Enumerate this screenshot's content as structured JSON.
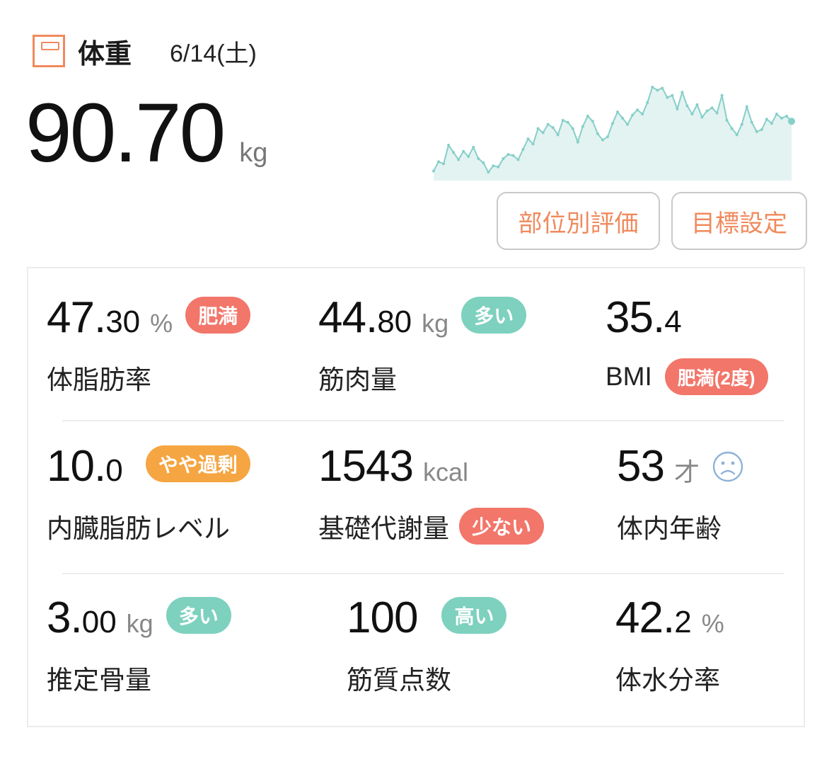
{
  "header": {
    "title": "体重",
    "date": "6/14(土)"
  },
  "weight": {
    "value": "90.70",
    "unit": "kg"
  },
  "trend": {
    "color": "#86cfc9",
    "fill": "#e3f3f1",
    "points": [
      90.5,
      91.4,
      91.2,
      93.0,
      92.3,
      91.6,
      92.4,
      91.9,
      92.8,
      91.7,
      91.3,
      90.4,
      91.0,
      90.9,
      91.7,
      92.1,
      92.0,
      91.6,
      92.6,
      93.6,
      93.1,
      94.6,
      94.2,
      95.0,
      94.7,
      94.0,
      95.4,
      95.2,
      94.6,
      93.3,
      94.8,
      95.8,
      95.3,
      94.1,
      93.5,
      93.8,
      95.1,
      96.2,
      95.6,
      95.0,
      95.9,
      96.4,
      96.0,
      97.1,
      98.6,
      98.3,
      98.5,
      97.6,
      97.8,
      96.5,
      98.1,
      96.8,
      96.0,
      96.9,
      95.7,
      96.3,
      96.6,
      96.1,
      97.8,
      95.4,
      94.6,
      94.0,
      95.0,
      96.7,
      95.2,
      94.3,
      94.5,
      95.5,
      95.1,
      96.0,
      95.6,
      95.8,
      95.3
    ]
  },
  "buttons": {
    "region": "部位別評価",
    "goal": "目標設定"
  },
  "metrics": {
    "body_fat": {
      "int": "47.",
      "dec": "30",
      "unit": "%",
      "badge": "肥満",
      "label": "体脂肪率"
    },
    "muscle": {
      "int": "44.",
      "dec": "80",
      "unit": "kg",
      "badge": "多い",
      "label": "筋肉量"
    },
    "bmi": {
      "int": "35.",
      "dec": "4",
      "badge": "肥満(2度)",
      "label": "BMI"
    },
    "visceral": {
      "int": "10.",
      "dec": "0",
      "badge": "やや過剰",
      "label": "内臓脂肪レベル"
    },
    "bmr": {
      "int": "1543",
      "unit": "kcal",
      "badge": "少ない",
      "label": "基礎代謝量"
    },
    "body_age": {
      "int": "53",
      "unit": "才",
      "face_icon": "sad-face-icon",
      "label": "体内年齢"
    },
    "bone": {
      "int": "3.",
      "dec": "00",
      "unit": "kg",
      "badge": "多い",
      "label": "推定骨量"
    },
    "muscle_quality": {
      "int": "100",
      "badge": "高い",
      "label": "筋質点数"
    },
    "water": {
      "int": "42.",
      "dec": "2",
      "unit": "%",
      "label": "体水分率"
    }
  },
  "colors": {
    "accent": "#f08a5d",
    "badge_red": "#f2766a",
    "badge_teal": "#7dd1be",
    "badge_orange": "#f5a541"
  }
}
